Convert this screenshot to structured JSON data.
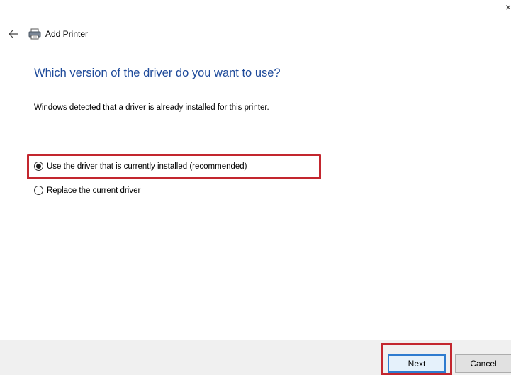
{
  "window": {
    "close_glyph": "×",
    "title": "Add Printer",
    "back_icon": "arrow-left-icon",
    "title_icon": "printer-icon"
  },
  "main": {
    "heading": "Which version of the driver do you want to use?",
    "description": "Windows detected that a driver is already installed for this printer.",
    "options": [
      {
        "label": "Use the driver that is currently installed (recommended)",
        "selected": true
      },
      {
        "label": "Replace the current driver",
        "selected": false
      }
    ]
  },
  "footer": {
    "next_label": "Next",
    "cancel_label": "Cancel"
  },
  "colors": {
    "heading": "#1e4a9a",
    "highlight": "#c3262e",
    "footer_bg": "#f0f0f0",
    "default_button_border": "#2e7bcf"
  }
}
